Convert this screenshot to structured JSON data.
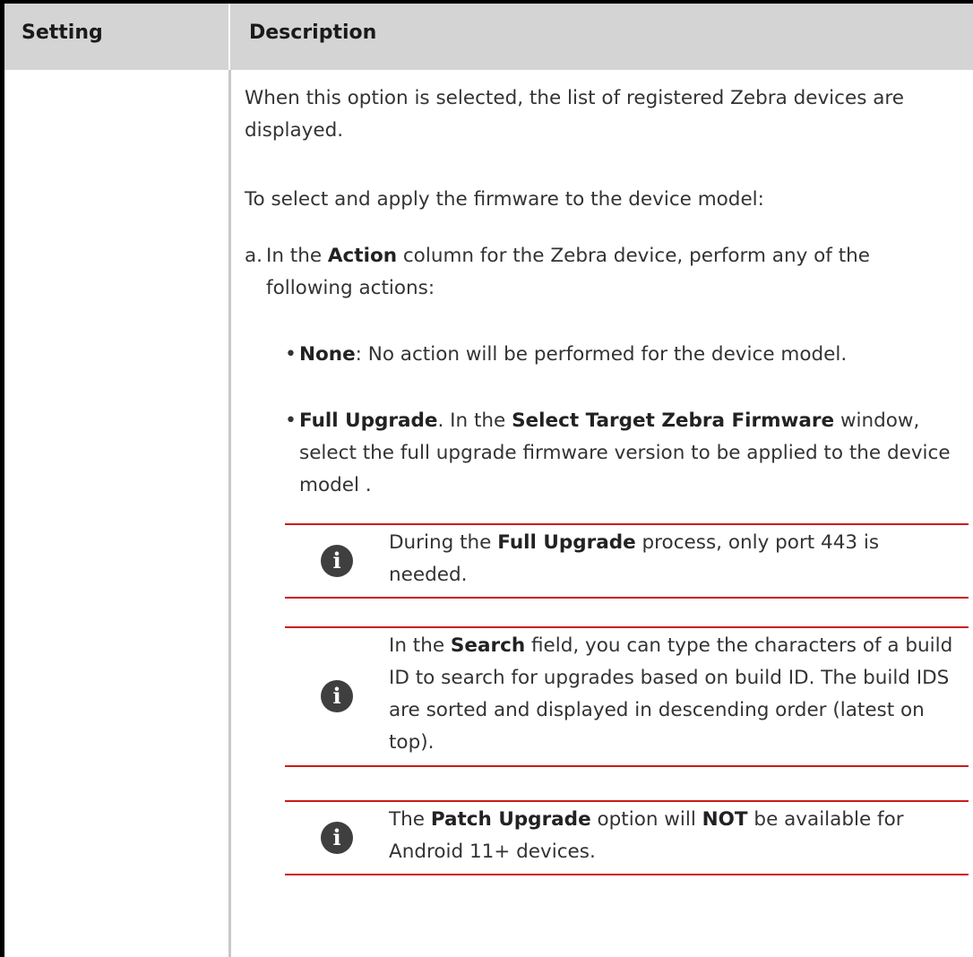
{
  "table": {
    "header": {
      "setting": "Setting",
      "description": "Description"
    }
  },
  "content": {
    "intro": "When this option is selected, the list of registered Zebra devices are displayed.",
    "instruction": "To select and apply the firmware to the device model:",
    "step_a": {
      "letter": "a.",
      "pre": "In the ",
      "bold": "Action",
      "post": " column for the Zebra device, perform any of the following actions:"
    },
    "bullets": [
      {
        "bold": "None",
        "text": ": No action will be performed for the device model."
      },
      {
        "bold": "Full Upgrade",
        "text1": ". In the ",
        "bold2": "Select Target Zebra Firmware",
        "text2": " window, select the full upgrade firmware version to be applied to the device model ."
      }
    ],
    "notes": [
      {
        "pre": "During the ",
        "bold": "Full Upgrade",
        "post": " process, only port 443 is needed."
      },
      {
        "pre": "In the ",
        "bold": "Search",
        "post": " field, you can type the characters of a build ID to search for upgrades based on build ID. The build IDS are sorted and displayed in descending order (latest on top)."
      },
      {
        "pre": "The ",
        "bold": "Patch Upgrade",
        "mid": " option will ",
        "bold2": "NOT",
        "post": " be available for Android 11+ devices."
      }
    ],
    "icon_glyph": "i"
  },
  "colors": {
    "header_bg": "#d4d4d4",
    "note_rule": "#cc1a1a",
    "icon_bg": "#3f3f3f"
  }
}
